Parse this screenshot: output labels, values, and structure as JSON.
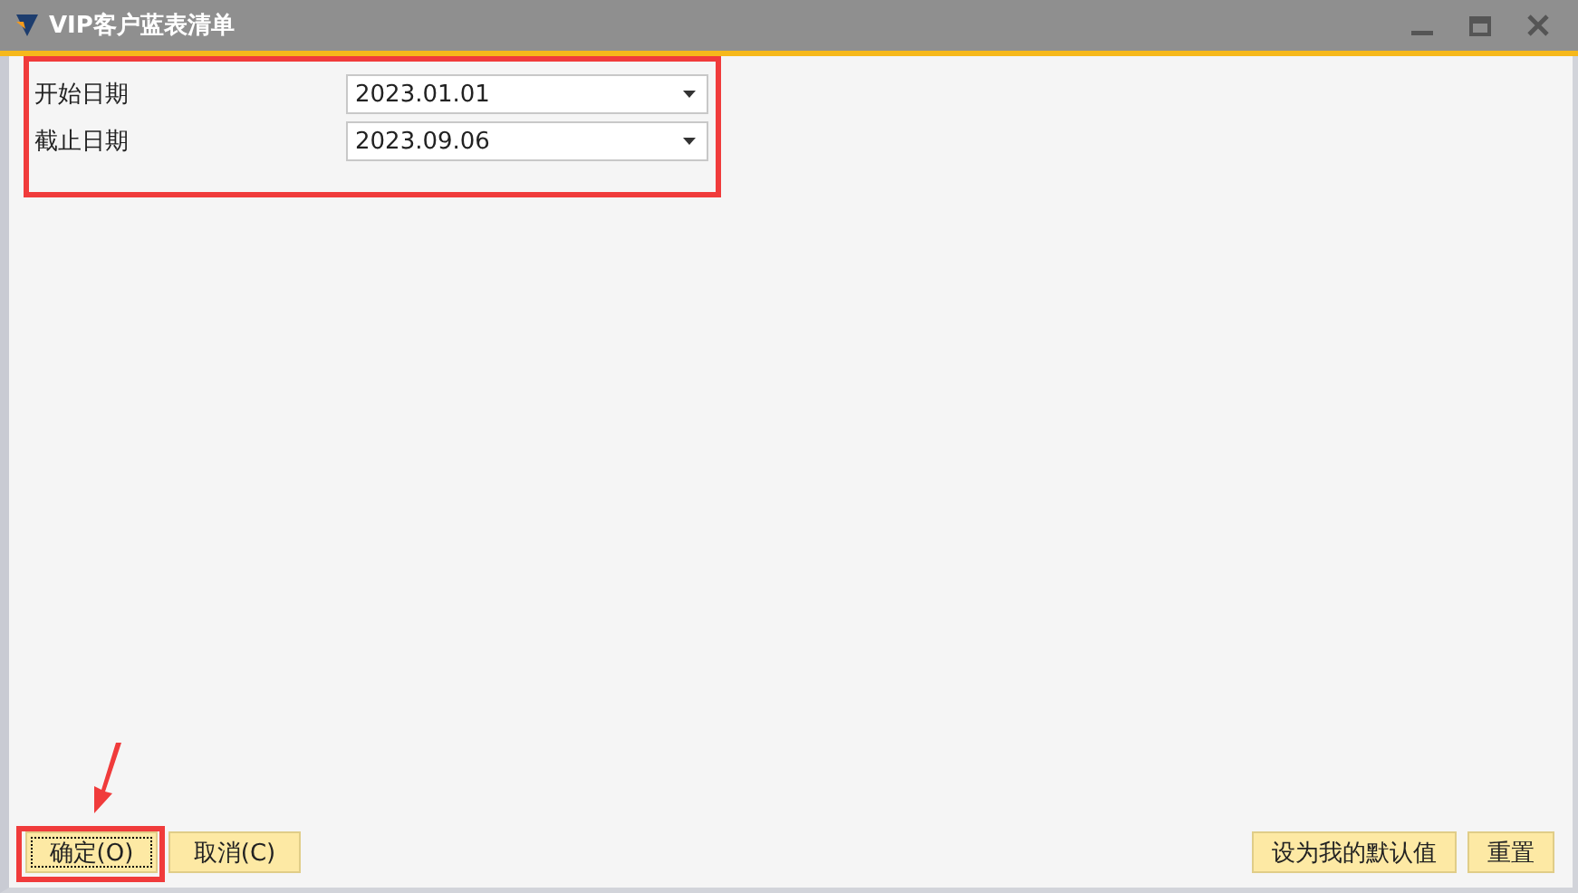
{
  "window": {
    "title": "VIP客户蓝表清单"
  },
  "fields": [
    {
      "label": "开始日期",
      "value": "2023.01.01"
    },
    {
      "label": "截止日期",
      "value": "2023.09.06"
    }
  ],
  "buttons_left": [
    {
      "label": "确定(O)",
      "focused": true
    },
    {
      "label": "取消(C)",
      "focused": false
    }
  ],
  "buttons_right": [
    {
      "label": "设为我的默认值",
      "focused": false
    },
    {
      "label": "重置",
      "focused": false
    }
  ]
}
